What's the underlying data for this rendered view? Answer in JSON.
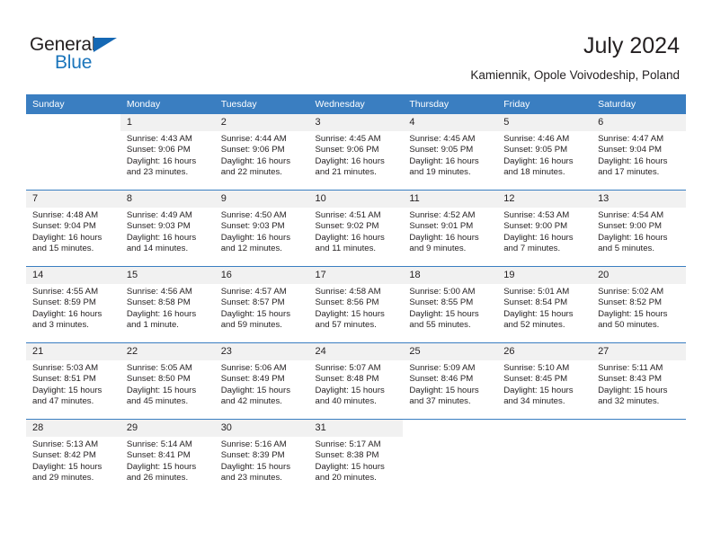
{
  "logo": {
    "word_top": "General",
    "word_bottom": "Blue",
    "triangle_icon": "triangle-icon",
    "brand_blue": "#1b75bb",
    "triangle_blue": "#1568b4"
  },
  "header": {
    "title": "July 2024",
    "subtitle": "Kamiennik, Opole Voivodeship, Poland"
  },
  "theme": {
    "header_row_bg": "#3a7ec1",
    "daynum_bg": "#f1f1f1",
    "text": "#231f20",
    "page_bg": "#ffffff"
  },
  "weekdays": [
    "Sunday",
    "Monday",
    "Tuesday",
    "Wednesday",
    "Thursday",
    "Friday",
    "Saturday"
  ],
  "labels": {
    "sunrise_prefix": "Sunrise:",
    "sunset_prefix": "Sunset:",
    "daylight_prefix": "Daylight:"
  },
  "weeks": [
    [
      {
        "day": "",
        "sunrise": "",
        "sunset": "",
        "daylight": ""
      },
      {
        "day": "1",
        "sunrise": "Sunrise: 4:43 AM",
        "sunset": "Sunset: 9:06 PM",
        "daylight": "Daylight: 16 hours and 23 minutes."
      },
      {
        "day": "2",
        "sunrise": "Sunrise: 4:44 AM",
        "sunset": "Sunset: 9:06 PM",
        "daylight": "Daylight: 16 hours and 22 minutes."
      },
      {
        "day": "3",
        "sunrise": "Sunrise: 4:45 AM",
        "sunset": "Sunset: 9:06 PM",
        "daylight": "Daylight: 16 hours and 21 minutes."
      },
      {
        "day": "4",
        "sunrise": "Sunrise: 4:45 AM",
        "sunset": "Sunset: 9:05 PM",
        "daylight": "Daylight: 16 hours and 19 minutes."
      },
      {
        "day": "5",
        "sunrise": "Sunrise: 4:46 AM",
        "sunset": "Sunset: 9:05 PM",
        "daylight": "Daylight: 16 hours and 18 minutes."
      },
      {
        "day": "6",
        "sunrise": "Sunrise: 4:47 AM",
        "sunset": "Sunset: 9:04 PM",
        "daylight": "Daylight: 16 hours and 17 minutes."
      }
    ],
    [
      {
        "day": "7",
        "sunrise": "Sunrise: 4:48 AM",
        "sunset": "Sunset: 9:04 PM",
        "daylight": "Daylight: 16 hours and 15 minutes."
      },
      {
        "day": "8",
        "sunrise": "Sunrise: 4:49 AM",
        "sunset": "Sunset: 9:03 PM",
        "daylight": "Daylight: 16 hours and 14 minutes."
      },
      {
        "day": "9",
        "sunrise": "Sunrise: 4:50 AM",
        "sunset": "Sunset: 9:03 PM",
        "daylight": "Daylight: 16 hours and 12 minutes."
      },
      {
        "day": "10",
        "sunrise": "Sunrise: 4:51 AM",
        "sunset": "Sunset: 9:02 PM",
        "daylight": "Daylight: 16 hours and 11 minutes."
      },
      {
        "day": "11",
        "sunrise": "Sunrise: 4:52 AM",
        "sunset": "Sunset: 9:01 PM",
        "daylight": "Daylight: 16 hours and 9 minutes."
      },
      {
        "day": "12",
        "sunrise": "Sunrise: 4:53 AM",
        "sunset": "Sunset: 9:00 PM",
        "daylight": "Daylight: 16 hours and 7 minutes."
      },
      {
        "day": "13",
        "sunrise": "Sunrise: 4:54 AM",
        "sunset": "Sunset: 9:00 PM",
        "daylight": "Daylight: 16 hours and 5 minutes."
      }
    ],
    [
      {
        "day": "14",
        "sunrise": "Sunrise: 4:55 AM",
        "sunset": "Sunset: 8:59 PM",
        "daylight": "Daylight: 16 hours and 3 minutes."
      },
      {
        "day": "15",
        "sunrise": "Sunrise: 4:56 AM",
        "sunset": "Sunset: 8:58 PM",
        "daylight": "Daylight: 16 hours and 1 minute."
      },
      {
        "day": "16",
        "sunrise": "Sunrise: 4:57 AM",
        "sunset": "Sunset: 8:57 PM",
        "daylight": "Daylight: 15 hours and 59 minutes."
      },
      {
        "day": "17",
        "sunrise": "Sunrise: 4:58 AM",
        "sunset": "Sunset: 8:56 PM",
        "daylight": "Daylight: 15 hours and 57 minutes."
      },
      {
        "day": "18",
        "sunrise": "Sunrise: 5:00 AM",
        "sunset": "Sunset: 8:55 PM",
        "daylight": "Daylight: 15 hours and 55 minutes."
      },
      {
        "day": "19",
        "sunrise": "Sunrise: 5:01 AM",
        "sunset": "Sunset: 8:54 PM",
        "daylight": "Daylight: 15 hours and 52 minutes."
      },
      {
        "day": "20",
        "sunrise": "Sunrise: 5:02 AM",
        "sunset": "Sunset: 8:52 PM",
        "daylight": "Daylight: 15 hours and 50 minutes."
      }
    ],
    [
      {
        "day": "21",
        "sunrise": "Sunrise: 5:03 AM",
        "sunset": "Sunset: 8:51 PM",
        "daylight": "Daylight: 15 hours and 47 minutes."
      },
      {
        "day": "22",
        "sunrise": "Sunrise: 5:05 AM",
        "sunset": "Sunset: 8:50 PM",
        "daylight": "Daylight: 15 hours and 45 minutes."
      },
      {
        "day": "23",
        "sunrise": "Sunrise: 5:06 AM",
        "sunset": "Sunset: 8:49 PM",
        "daylight": "Daylight: 15 hours and 42 minutes."
      },
      {
        "day": "24",
        "sunrise": "Sunrise: 5:07 AM",
        "sunset": "Sunset: 8:48 PM",
        "daylight": "Daylight: 15 hours and 40 minutes."
      },
      {
        "day": "25",
        "sunrise": "Sunrise: 5:09 AM",
        "sunset": "Sunset: 8:46 PM",
        "daylight": "Daylight: 15 hours and 37 minutes."
      },
      {
        "day": "26",
        "sunrise": "Sunrise: 5:10 AM",
        "sunset": "Sunset: 8:45 PM",
        "daylight": "Daylight: 15 hours and 34 minutes."
      },
      {
        "day": "27",
        "sunrise": "Sunrise: 5:11 AM",
        "sunset": "Sunset: 8:43 PM",
        "daylight": "Daylight: 15 hours and 32 minutes."
      }
    ],
    [
      {
        "day": "28",
        "sunrise": "Sunrise: 5:13 AM",
        "sunset": "Sunset: 8:42 PM",
        "daylight": "Daylight: 15 hours and 29 minutes."
      },
      {
        "day": "29",
        "sunrise": "Sunrise: 5:14 AM",
        "sunset": "Sunset: 8:41 PM",
        "daylight": "Daylight: 15 hours and 26 minutes."
      },
      {
        "day": "30",
        "sunrise": "Sunrise: 5:16 AM",
        "sunset": "Sunset: 8:39 PM",
        "daylight": "Daylight: 15 hours and 23 minutes."
      },
      {
        "day": "31",
        "sunrise": "Sunrise: 5:17 AM",
        "sunset": "Sunset: 8:38 PM",
        "daylight": "Daylight: 15 hours and 20 minutes."
      },
      {
        "day": "",
        "sunrise": "",
        "sunset": "",
        "daylight": ""
      },
      {
        "day": "",
        "sunrise": "",
        "sunset": "",
        "daylight": ""
      },
      {
        "day": "",
        "sunrise": "",
        "sunset": "",
        "daylight": ""
      }
    ]
  ]
}
